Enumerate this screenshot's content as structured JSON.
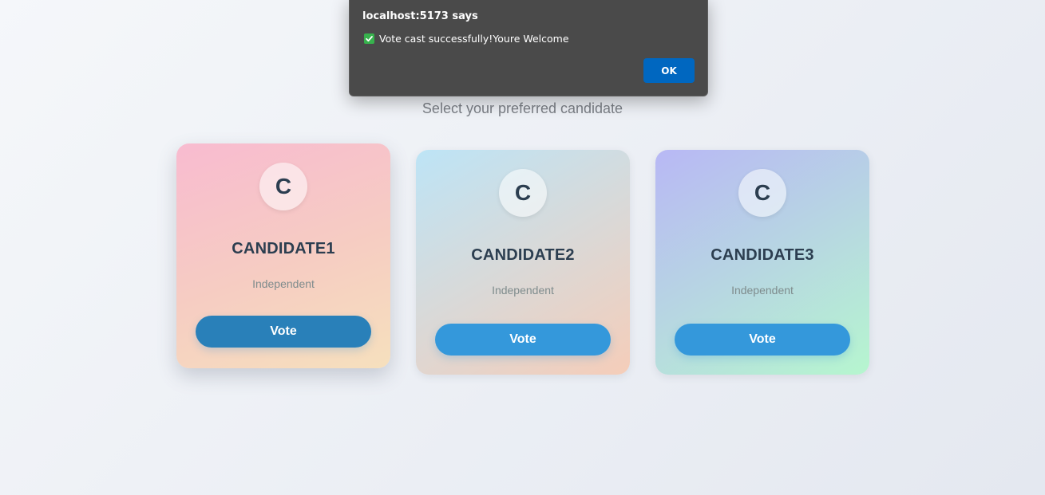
{
  "page": {
    "subtitle": "Select your preferred candidate"
  },
  "candidates": [
    {
      "initial": "C",
      "name": "CANDIDATE1",
      "party": "Independent",
      "vote_label": "Vote"
    },
    {
      "initial": "C",
      "name": "CANDIDATE2",
      "party": "Independent",
      "vote_label": "Vote"
    },
    {
      "initial": "C",
      "name": "CANDIDATE3",
      "party": "Independent",
      "vote_label": "Vote"
    }
  ],
  "alert": {
    "title": "localhost:5173 says",
    "icon": "check-mark-icon",
    "message": "Vote cast successfully!Youre Welcome",
    "ok_label": "OK"
  },
  "colors": {
    "vote_button": "#3498db",
    "vote_button_hover": "#2980b9",
    "dialog_bg": "#4a4a4a",
    "ok_button": "#0067c0",
    "check_green": "#37b24d"
  }
}
